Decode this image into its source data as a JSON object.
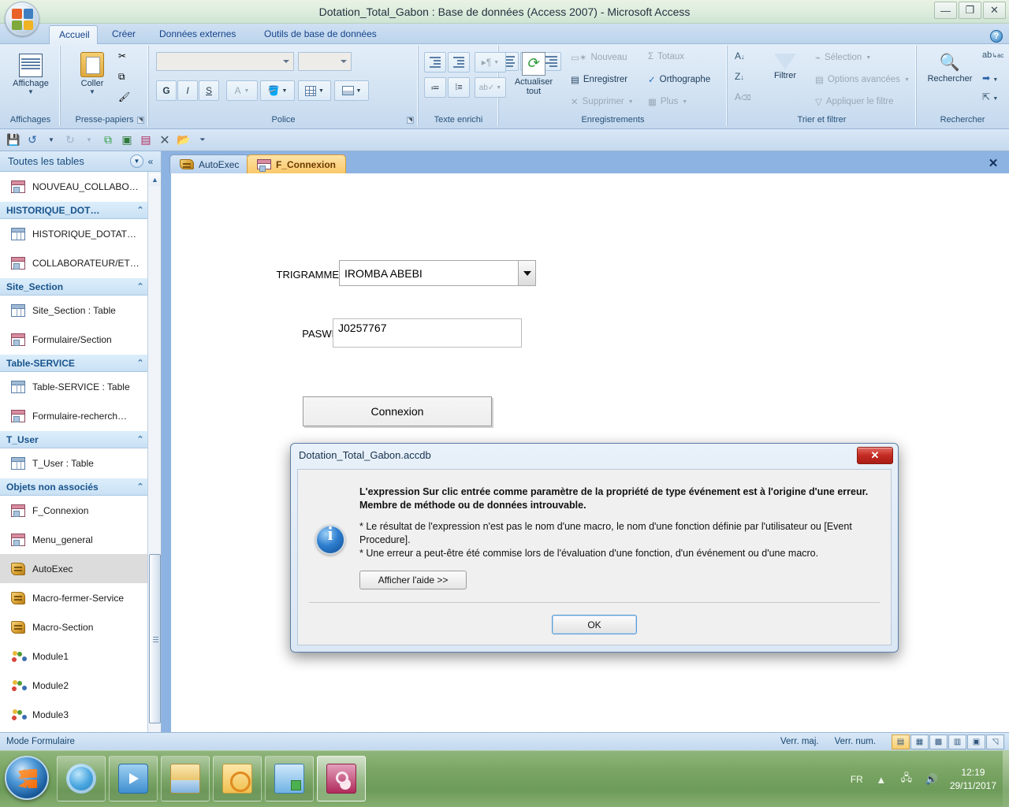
{
  "window": {
    "title": "Dotation_Total_Gabon : Base de données (Access 2007)  -  Microsoft Access",
    "minimize": "—",
    "restore": "❐",
    "close": "✕",
    "help": "?"
  },
  "ribbon": {
    "tabs": [
      {
        "label": "Accueil",
        "active": true
      },
      {
        "label": "Créer",
        "active": false
      },
      {
        "label": "Données externes",
        "active": false
      },
      {
        "label": "Outils de base de données",
        "active": false
      }
    ],
    "groups": [
      {
        "name": "Affichages"
      },
      {
        "name": "Presse-papiers"
      },
      {
        "name": "Police"
      },
      {
        "name": "Texte enrichi"
      },
      {
        "name": "Enregistrements"
      },
      {
        "name": "Trier et filtrer"
      },
      {
        "name": "Rechercher"
      }
    ],
    "affichage_button": "Affichage",
    "coller_button": "Coller",
    "actualiser_button_line1": "Actualiser",
    "actualiser_button_line2": "tout",
    "filtrer_button": "Filtrer",
    "rechercher_button": "Rechercher",
    "records_commands": [
      {
        "label": "Nouveau",
        "disabled": true
      },
      {
        "label": "Enregistrer",
        "disabled": false
      },
      {
        "label": "Supprimer",
        "disabled": true
      },
      {
        "label": "Totaux",
        "disabled": true
      },
      {
        "label": "Orthographe",
        "disabled": false
      },
      {
        "label": "Plus",
        "disabled": true
      }
    ],
    "filter_commands": [
      {
        "label": "Sélection",
        "disabled": true
      },
      {
        "label": "Options avancées",
        "disabled": true
      },
      {
        "label": "Appliquer le filtre",
        "disabled": true
      }
    ],
    "font_controls": {
      "font_name": "",
      "font_size": "",
      "bold": "G",
      "italic": "I",
      "underline": "S"
    }
  },
  "quick_access": {
    "icons": [
      "save-icon",
      "undo-icon",
      "undo-dropdown-icon",
      "redo-icon",
      "redo-dropdown-icon",
      "refresh-all-icon",
      "datasheet-icon",
      "form-icon",
      "close-icon",
      "open-icon",
      "customize-icon"
    ]
  },
  "navpane": {
    "header_title": "Toutes les tables",
    "dropdown_icon": "▼",
    "collapse_icon": "«",
    "sections": [
      {
        "type": "item",
        "icon": "form-icon",
        "label": "NOUVEAU_COLLABO…",
        "selected": false
      },
      {
        "type": "group",
        "label": "HISTORIQUE_DOT…",
        "chevron": "⌃"
      },
      {
        "type": "item",
        "icon": "table-icon",
        "label": "HISTORIQUE_DOTAT…",
        "selected": false
      },
      {
        "type": "item",
        "icon": "form-icon",
        "label": "COLLABORATEUR/ET…",
        "selected": false
      },
      {
        "type": "group",
        "label": "Site_Section",
        "chevron": "⌃"
      },
      {
        "type": "item",
        "icon": "table-icon",
        "label": "Site_Section : Table",
        "selected": false
      },
      {
        "type": "item",
        "icon": "form-icon",
        "label": "Formulaire/Section",
        "selected": false
      },
      {
        "type": "group",
        "label": "Table-SERVICE",
        "chevron": "⌃"
      },
      {
        "type": "item",
        "icon": "table-icon",
        "label": "Table-SERVICE : Table",
        "selected": false
      },
      {
        "type": "item",
        "icon": "form-icon",
        "label": "Formulaire-recherch…",
        "selected": false
      },
      {
        "type": "group",
        "label": "T_User",
        "chevron": "⌃"
      },
      {
        "type": "item",
        "icon": "table-icon",
        "label": "T_User : Table",
        "selected": false
      },
      {
        "type": "group",
        "label": "Objets non associés",
        "chevron": "⌃"
      },
      {
        "type": "item",
        "icon": "form-icon",
        "label": "F_Connexion",
        "selected": false
      },
      {
        "type": "item",
        "icon": "form-icon",
        "label": "Menu_general",
        "selected": false
      },
      {
        "type": "item",
        "icon": "macro-icon",
        "label": "AutoExec",
        "selected": true
      },
      {
        "type": "item",
        "icon": "macro-icon",
        "label": "Macro-fermer-Service",
        "selected": false
      },
      {
        "type": "item",
        "icon": "macro-icon",
        "label": "Macro-Section",
        "selected": false
      },
      {
        "type": "item",
        "icon": "module-icon",
        "label": "Module1",
        "selected": false
      },
      {
        "type": "item",
        "icon": "module-icon",
        "label": "Module2",
        "selected": false
      },
      {
        "type": "item",
        "icon": "module-icon",
        "label": "Module3",
        "selected": false
      }
    ]
  },
  "document": {
    "tabs": [
      {
        "label": "AutoExec",
        "icon": "macro-icon",
        "active": false
      },
      {
        "label": "F_Connexion",
        "icon": "form-icon",
        "active": true
      }
    ],
    "close_icon": "✕",
    "form": {
      "trigramme_label": "TRIGRAMME",
      "trigramme_value": "IROMBA ABEBI",
      "trigramme_dropdown_icon": "▼",
      "paswd_label": "PASWD",
      "paswd_value": "J0257767",
      "connexion_button": "Connexion"
    }
  },
  "dialog": {
    "title": "Dotation_Total_Gabon.accdb",
    "close_label": "✕",
    "icon": "info-icon",
    "message_bold": "L'expression Sur clic entrée comme paramètre de la propriété de type événement est à l'origine d'une erreur. Membre de méthode ou de données introuvable.",
    "message_line1": "* Le résultat de l'expression n'est pas le nom d'une macro, le nom d'une fonction définie par l'utilisateur ou [Event Procedure].",
    "message_line2": "* Une erreur a peut-être été commise lors de l'évaluation d'une fonction, d'un événement ou d'une macro.",
    "help_button": "Afficher l'aide >>",
    "ok_button": "OK"
  },
  "statusbar": {
    "mode": "Mode Formulaire",
    "caps_lock": "Verr. maj.",
    "num_lock": "Verr. num.",
    "views": [
      {
        "name": "form-view",
        "glyph": "▤",
        "active": true
      },
      {
        "name": "datasheet-view",
        "glyph": "▦",
        "active": false
      },
      {
        "name": "pivottable-view",
        "glyph": "▩",
        "active": false
      },
      {
        "name": "pivotchart-view",
        "glyph": "▥",
        "active": false
      },
      {
        "name": "layout-view",
        "glyph": "▣",
        "active": false
      },
      {
        "name": "design-view",
        "glyph": "◹",
        "active": false
      }
    ]
  },
  "taskbar": {
    "start_label": "start-orb",
    "items": [
      {
        "name": "internet-explorer-icon",
        "active": false
      },
      {
        "name": "windows-media-player-icon",
        "active": false
      },
      {
        "name": "file-explorer-icon",
        "active": false
      },
      {
        "name": "outlook-icon",
        "active": false
      },
      {
        "name": "lync-icon",
        "active": false
      },
      {
        "name": "microsoft-access-icon",
        "active": true
      }
    ],
    "language": "FR",
    "time": "12:19",
    "date": "29/11/2017",
    "show_hidden_icon": "▲",
    "network_icon": "network",
    "volume_icon": "volume"
  }
}
